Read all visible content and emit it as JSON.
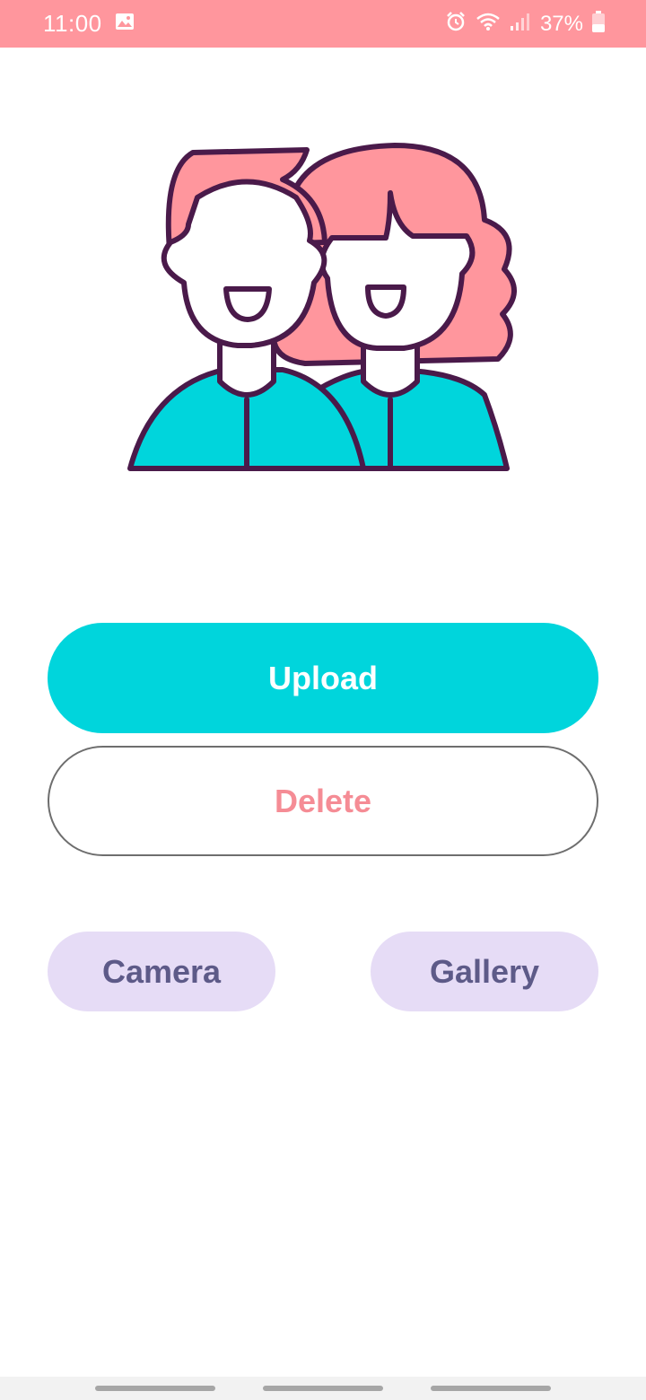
{
  "status_bar": {
    "time": "11:00",
    "battery_percent": "37%",
    "icons": [
      "image-icon",
      "alarm-icon",
      "wifi-icon",
      "signal-icon",
      "battery-icon"
    ]
  },
  "illustration": {
    "icon": "two-people-avatar-icon",
    "colors": {
      "hair": "#ff969d",
      "shirt": "#00d5dc",
      "outline": "#4a1a4a",
      "face": "#ffffff"
    }
  },
  "buttons": {
    "upload": "Upload",
    "delete": "Delete",
    "camera": "Camera",
    "gallery": "Gallery"
  },
  "colors": {
    "status_bar": "#ff969d",
    "primary": "#00d5dc",
    "delete_text": "#f58c95",
    "chip_bg": "#e6dcf6",
    "chip_text": "#5d5a88"
  }
}
